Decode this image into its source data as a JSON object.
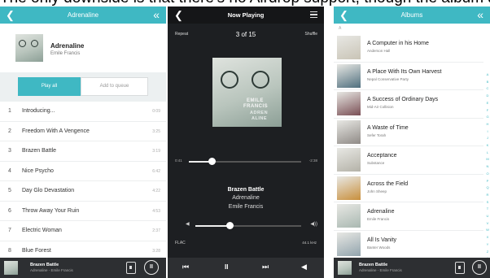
{
  "caption": "The only downside is that there's no Airdrop support, though the album art and menus are nicely designed",
  "album_screen": {
    "header_title": "Adrenaline",
    "back_icon": "chevron-left-icon",
    "collapse_icon": "double-chevron-icon",
    "album_title": "Adrenaline",
    "album_artist": "Emile Francis",
    "play_all_label": "Play all",
    "add_to_queue_label": "Add to queue",
    "tracks": [
      {
        "num": "1",
        "name": "Introducing...",
        "duration": "0:09"
      },
      {
        "num": "2",
        "name": "Freedom With A Vengence",
        "duration": "3:25"
      },
      {
        "num": "3",
        "name": "Brazen Battle",
        "duration": "3:19"
      },
      {
        "num": "4",
        "name": "Nice Psycho",
        "duration": "6:42"
      },
      {
        "num": "5",
        "name": "Day Glo Devastation",
        "duration": "4:22"
      },
      {
        "num": "6",
        "name": "Throw Away Your Ruin",
        "duration": "4:53"
      },
      {
        "num": "7",
        "name": "Electric Woman",
        "duration": "2:37"
      },
      {
        "num": "8",
        "name": "Blue Forest",
        "duration": "3:28"
      }
    ]
  },
  "mini_player": {
    "song": "Brazen Battle",
    "album_artist": "Adrenaline - Emile Francis",
    "pause_glyph": "II"
  },
  "now_playing": {
    "title": "Now Playing",
    "repeat_label": "Repeat",
    "shuffle_label": "Shuffle",
    "counter": "3 of 15",
    "art_name": "EMILE",
    "art_name2": "FRANCIS",
    "art_album1": "ADREN",
    "art_album2": "ALINE",
    "elapsed": "0:41",
    "remaining": "-2:38",
    "progress": 0.21,
    "song": "Brazen Battle",
    "album": "Adrenaline",
    "artist": "Emile Francis",
    "volume": 0.33,
    "format": "FLAC",
    "sample_rate": "44.1 kHz",
    "prev_glyph": "⏮",
    "pause_glyph": "II",
    "next_glyph": "⏭",
    "speaker_glyph": "◀"
  },
  "albums_screen": {
    "header_title": "Albums",
    "section_letter": "A",
    "albums": [
      {
        "name": "A Computer in his Home",
        "artist": "Anderson Hall",
        "color": "#c9c4b6"
      },
      {
        "name": "A Place With Its Own Harvest",
        "artist": "Nepal Conservative Party",
        "color": "#4f6f7e"
      },
      {
        "name": "A Success of Ordinary Days",
        "artist": "Mid-Air Collision",
        "color": "#7a4f55"
      },
      {
        "name": "A Waste of Time",
        "artist": "Sefer Torah",
        "color": "#8f8a86"
      },
      {
        "name": "Acceptance",
        "artist": "Substance",
        "color": "#b4b2a8"
      },
      {
        "name": "Across the Field",
        "artist": "John Sheep",
        "color": "#c88f3c"
      },
      {
        "name": "Adrenaline",
        "artist": "Emile Francis",
        "color": "#a9b8b1"
      },
      {
        "name": "All Is Vanity",
        "artist": "Banter Woods",
        "color": "#92a4ad"
      }
    ],
    "index_letters": [
      "A",
      "B",
      "C",
      "D",
      "E",
      "F",
      "G",
      "H",
      "I",
      "J",
      "K",
      "L",
      "M",
      "N",
      "O",
      "P",
      "Q",
      "R",
      "S",
      "T",
      "U",
      "V",
      "W",
      "X",
      "Y",
      "Z",
      "#"
    ]
  },
  "colors": {
    "accent": "#3fb8c3",
    "dark": "#1d1f22",
    "mini_bar": "#2d2f32"
  }
}
